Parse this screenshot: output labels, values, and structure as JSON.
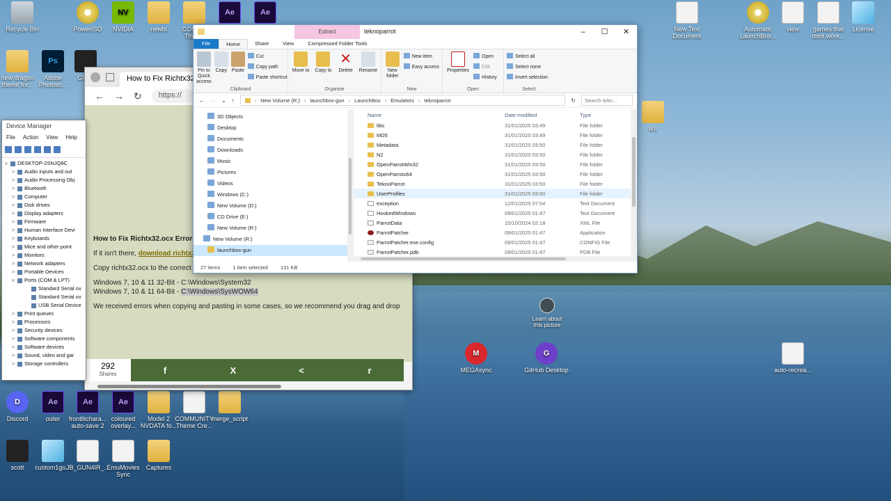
{
  "desktop": {
    "icons_top": [
      {
        "label": "Recycle Bin",
        "icon": "recycle-bin-icon",
        "cls": "bin",
        "glyph": ""
      },
      {
        "label": "PowerISO",
        "icon": "disc-icon",
        "cls": "disc",
        "glyph": ""
      },
      {
        "label": "NVIDIA",
        "icon": "nvidia-icon",
        "cls": "nv",
        "glyph": "NV"
      },
      {
        "label": "newbl",
        "icon": "folder-icon",
        "cls": "folder",
        "glyph": ""
      },
      {
        "label": "COMMU Theme",
        "icon": "folder-icon",
        "cls": "folder",
        "glyph": ""
      },
      {
        "label": "",
        "icon": "after-effects-icon",
        "cls": "ae",
        "glyph": "Ae"
      },
      {
        "label": "",
        "icon": "after-effects-icon",
        "cls": "ae",
        "glyph": "Ae"
      }
    ],
    "icons_left": [
      {
        "label": "new dragon theme for...",
        "icon": "folder-icon",
        "cls": "folder",
        "glyph": ""
      },
      {
        "label": "Adobe Photosh...",
        "icon": "photoshop-icon",
        "cls": "ps",
        "glyph": "Ps"
      },
      {
        "label": "GIMP",
        "icon": "gimp-icon",
        "cls": "dark",
        "glyph": ""
      }
    ],
    "icons_right": [
      {
        "label": "New Text Document",
        "icon": "file-icon",
        "cls": "file",
        "glyph": ""
      },
      {
        "label": "Automatic LaunchBox...",
        "icon": "disc-icon",
        "cls": "disc",
        "glyph": ""
      },
      {
        "label": "view",
        "icon": "gear-icon",
        "cls": "file",
        "glyph": ""
      },
      {
        "label": "games that dont work...",
        "icon": "file-icon",
        "cls": "file",
        "glyph": ""
      },
      {
        "label": "License",
        "icon": "glass-icon",
        "cls": "glass",
        "glyph": ""
      },
      {
        "label": "lirli",
        "icon": "folder-icon",
        "cls": "folder",
        "glyph": ""
      }
    ],
    "icons_bottom1": [
      {
        "label": "Discord",
        "icon": "discord-icon",
        "cls": "disc2",
        "glyph": "D"
      },
      {
        "label": "outer",
        "icon": "after-effects-icon",
        "cls": "ae",
        "glyph": "Ae"
      },
      {
        "label": "frontlitchara... auto-save 2",
        "icon": "after-effects-icon",
        "cls": "ae",
        "glyph": "Ae"
      },
      {
        "label": "coloured overlay...",
        "icon": "after-effects-icon",
        "cls": "ae",
        "glyph": "Ae"
      },
      {
        "label": "Model 2 NVDATA fo...",
        "icon": "folder-icon",
        "cls": "folder",
        "glyph": ""
      },
      {
        "label": "COMMUNITY Theme Cre...",
        "icon": "file-icon",
        "cls": "file",
        "glyph": ""
      },
      {
        "label": "merge_script",
        "icon": "folder-icon",
        "cls": "folder",
        "glyph": ""
      }
    ],
    "icons_bottom2": [
      {
        "label": "scott",
        "icon": "user-icon",
        "cls": "dark",
        "glyph": ""
      },
      {
        "label": "custom1gu...",
        "icon": "glass-icon",
        "cls": "glass",
        "glyph": ""
      },
      {
        "label": "JB_GUN4IR_...",
        "icon": "file-icon",
        "cls": "file",
        "glyph": ""
      },
      {
        "label": "EmuMovies Sync",
        "icon": "gamepad-icon",
        "cls": "file",
        "glyph": ""
      },
      {
        "label": "Captures",
        "icon": "folder-icon",
        "cls": "folder",
        "glyph": ""
      }
    ],
    "mid_icons": [
      {
        "label": "MEGAsync",
        "icon": "mega-icon",
        "cls": "mega",
        "glyph": "M"
      },
      {
        "label": "GitHub Desktop",
        "icon": "github-icon",
        "cls": "gh",
        "glyph": "G"
      },
      {
        "label": "auto-recrea...",
        "icon": "file-icon",
        "cls": "file",
        "glyph": ""
      }
    ],
    "learn_label": "Learn about this picture"
  },
  "browser": {
    "tab_title": "How to Fix Richtx32.o",
    "url": "https://",
    "article": {
      "heading": "How to Fix Richtx32.ocx Errors - Richtx32.ocx Missing",
      "p1_pre": "If it isn't there, ",
      "p1_link": "download richtx32.ocx from MajorGeeks",
      "p1_post": ".",
      "p2": "Copy richtx32.ocx to the correct folder:",
      "p3a": "Windows 7, 10 & 11 32-Bit - C:\\Windows\\System32",
      "p3b_pre": "Windows 7, 10 & 11 64-Bit - ",
      "p3b_hl": "C:\\Windows\\SysWOW64",
      "p4": "We received errors when copying and pasting in some cases, so we recommend you drag and drop"
    },
    "share": {
      "count": "292",
      "count_label": "Shares",
      "buttons": [
        "f",
        "X",
        "<",
        "r"
      ]
    }
  },
  "device_manager": {
    "title": "Device Manager",
    "menu": [
      "File",
      "Action",
      "View",
      "Help"
    ],
    "root": "DESKTOP-2SNJQ8C",
    "items": [
      {
        "label": "Audio inputs and out",
        "lvl": 1,
        "ex": ">"
      },
      {
        "label": "Audio Processing Obj",
        "lvl": 1,
        "ex": ">"
      },
      {
        "label": "Bluetooth",
        "lvl": 1,
        "ex": ">"
      },
      {
        "label": "Computer",
        "lvl": 1,
        "ex": ">"
      },
      {
        "label": "Disk drives",
        "lvl": 1,
        "ex": ">"
      },
      {
        "label": "Display adapters",
        "lvl": 1,
        "ex": ">"
      },
      {
        "label": "Firmware",
        "lvl": 1,
        "ex": ">"
      },
      {
        "label": "Human Interface Devi",
        "lvl": 1,
        "ex": ">"
      },
      {
        "label": "Keyboards",
        "lvl": 1,
        "ex": ">"
      },
      {
        "label": "Mice and other point",
        "lvl": 1,
        "ex": ">"
      },
      {
        "label": "Monitors",
        "lvl": 1,
        "ex": ">"
      },
      {
        "label": "Network adapters",
        "lvl": 1,
        "ex": ">"
      },
      {
        "label": "Portable Devices",
        "lvl": 1,
        "ex": ">"
      },
      {
        "label": "Ports (COM & LPT)",
        "lvl": 1,
        "ex": "v"
      },
      {
        "label": "Standard Serial ov",
        "lvl": 2,
        "ex": ""
      },
      {
        "label": "Standard Serial ov",
        "lvl": 2,
        "ex": ""
      },
      {
        "label": "USB Serial Device",
        "lvl": 2,
        "ex": ""
      },
      {
        "label": "Print queues",
        "lvl": 1,
        "ex": ">"
      },
      {
        "label": "Processors",
        "lvl": 1,
        "ex": ">"
      },
      {
        "label": "Security devices",
        "lvl": 1,
        "ex": ">"
      },
      {
        "label": "Software components",
        "lvl": 1,
        "ex": ">"
      },
      {
        "label": "Software devices",
        "lvl": 1,
        "ex": ">"
      },
      {
        "label": "Sound, video and gar",
        "lvl": 1,
        "ex": ">"
      },
      {
        "label": "Storage controllers",
        "lvl": 1,
        "ex": ">"
      }
    ]
  },
  "explorer": {
    "context_tab": "Extract",
    "window_title": "teknoparrot",
    "controls": [
      "–",
      "☐",
      "✕"
    ],
    "tabs": [
      "File",
      "Home",
      "Share",
      "View",
      "Compressed Folder Tools"
    ],
    "ribbon": {
      "clipboard": {
        "name": "Clipboard",
        "pin": "Pin to Quick access",
        "copy": "Copy",
        "paste": "Paste",
        "cut": "Cut",
        "copy_path": "Copy path",
        "paste_shortcut": "Paste shortcut"
      },
      "organise": {
        "name": "Organise",
        "move": "Move to",
        "copy": "Copy to",
        "delete": "Delete",
        "rename": "Rename"
      },
      "new": {
        "name": "New",
        "new_folder": "New folder",
        "new_item": "New item",
        "easy_access": "Easy access"
      },
      "open": {
        "name": "Open",
        "properties": "Properties",
        "open": "Open",
        "edit": "Edit",
        "history": "History"
      },
      "select": {
        "name": "Select",
        "all": "Select all",
        "none": "Select none",
        "invert": "Invert selection"
      }
    },
    "path": [
      "New Volume (R:)",
      "launchbox-gun",
      "LaunchBox",
      "Emulators",
      "teknoparrot"
    ],
    "search_placeholder": "Search tekn...",
    "nav": [
      {
        "label": "3D Objects",
        "fold": false,
        "sel": false,
        "indent": 20
      },
      {
        "label": "Desktop",
        "fold": false,
        "sel": false,
        "indent": 20
      },
      {
        "label": "Documents",
        "fold": false,
        "sel": false,
        "indent": 20
      },
      {
        "label": "Downloads",
        "fold": false,
        "sel": false,
        "indent": 20
      },
      {
        "label": "Music",
        "fold": false,
        "sel": false,
        "indent": 20
      },
      {
        "label": "Pictures",
        "fold": false,
        "sel": false,
        "indent": 20
      },
      {
        "label": "Videos",
        "fold": false,
        "sel": false,
        "indent": 20
      },
      {
        "label": "Windows (C:)",
        "fold": false,
        "sel": false,
        "indent": 20
      },
      {
        "label": "New Volume (D:)",
        "fold": false,
        "sel": false,
        "indent": 20
      },
      {
        "label": "CD Drive (E:)",
        "fold": false,
        "sel": false,
        "indent": 20
      },
      {
        "label": "New Volume (R:)",
        "fold": false,
        "sel": false,
        "indent": 20
      },
      {
        "label": "New Volume (R:)",
        "fold": false,
        "sel": false,
        "indent": 14
      },
      {
        "label": "launchbox-gun",
        "fold": true,
        "sel": true,
        "indent": 20
      }
    ],
    "columns": [
      "Name",
      "Date modified",
      "Type"
    ],
    "files": [
      {
        "name": "libs",
        "date": "31/01/2025 03:49",
        "type": "File folder",
        "kind": "folder"
      },
      {
        "name": "MD5",
        "date": "31/01/2025 03:49",
        "type": "File folder",
        "kind": "folder"
      },
      {
        "name": "Metadata",
        "date": "31/01/2025 03:50",
        "type": "File folder",
        "kind": "folder"
      },
      {
        "name": "N2",
        "date": "31/01/2025 03:50",
        "type": "File folder",
        "kind": "folder"
      },
      {
        "name": "OpenParrotWin32",
        "date": "31/01/2025 03:50",
        "type": "File folder",
        "kind": "folder"
      },
      {
        "name": "OpenParrotx64",
        "date": "31/01/2025 03:50",
        "type": "File folder",
        "kind": "folder"
      },
      {
        "name": "TeknoParrot",
        "date": "31/01/2025 03:50",
        "type": "File folder",
        "kind": "folder"
      },
      {
        "name": "UserProfiles",
        "date": "31/01/2025 03:50",
        "type": "File folder",
        "kind": "folder",
        "hover": true
      },
      {
        "name": "exception",
        "date": "12/01/2025 07:54",
        "type": "Text Document",
        "kind": "doc"
      },
      {
        "name": "HookedWindows",
        "date": "09/01/2025 01:47",
        "type": "Text Document",
        "kind": "doc"
      },
      {
        "name": "ParrotData",
        "date": "15/10/2024 02:18",
        "type": "XML File",
        "kind": "doc"
      },
      {
        "name": "ParrotPatcher",
        "date": "09/01/2025 01:47",
        "type": "Application",
        "kind": "app"
      },
      {
        "name": "ParrotPatcher.exe.config",
        "date": "09/01/2025 01:47",
        "type": "CONFIG File",
        "kind": "cfg"
      },
      {
        "name": "ParrotPatcher.pdb",
        "date": "09/01/2025 01:47",
        "type": "PDB File",
        "kind": "cfg"
      }
    ],
    "status": {
      "count": "27 items",
      "selected": "1 item selected",
      "size": "131 KB"
    }
  }
}
